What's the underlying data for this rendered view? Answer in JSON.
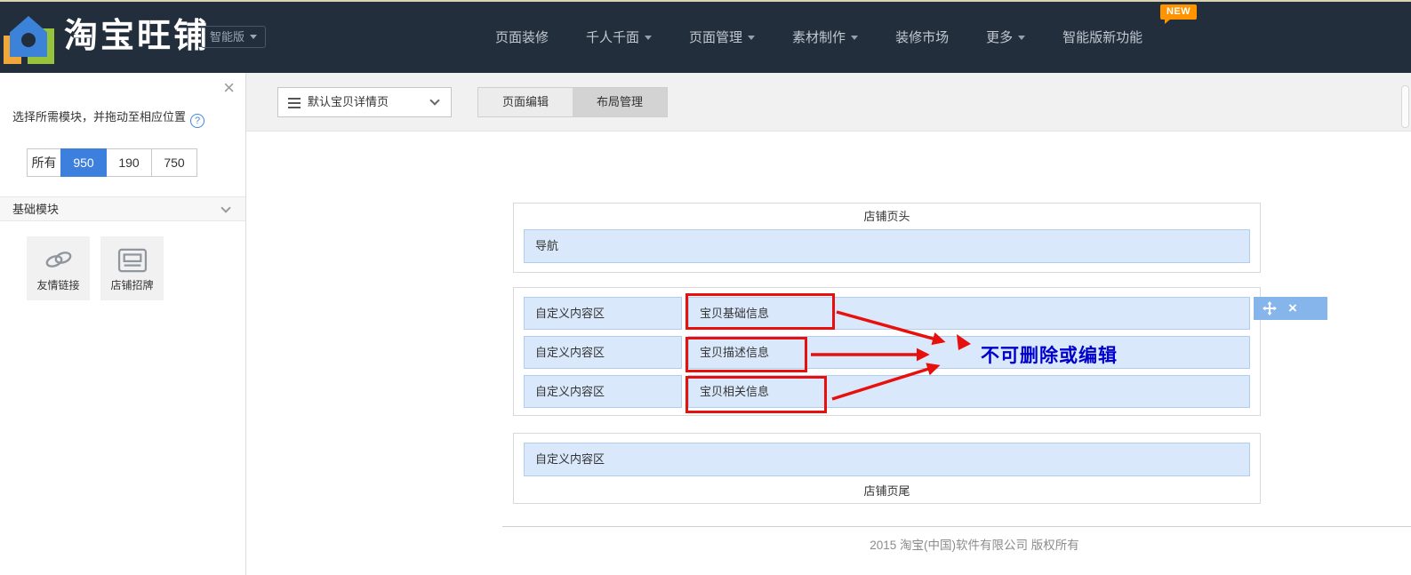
{
  "header": {
    "logo_text": "淘宝旺铺",
    "version_button": "智能版",
    "nav": [
      {
        "label": "页面装修",
        "dropdown": false
      },
      {
        "label": "千人千面",
        "dropdown": true
      },
      {
        "label": "页面管理",
        "dropdown": true
      },
      {
        "label": "素材制作",
        "dropdown": true
      },
      {
        "label": "装修市场",
        "dropdown": false
      },
      {
        "label": "更多",
        "dropdown": true
      },
      {
        "label": "智能版新功能",
        "dropdown": false,
        "badge": "NEW"
      }
    ]
  },
  "sidebar": {
    "instruction": "选择所需模块，并拖动至相应位置",
    "size_tabs": [
      {
        "label": "所有",
        "active": false
      },
      {
        "label": "950",
        "active": true
      },
      {
        "label": "190",
        "active": false
      },
      {
        "label": "750",
        "active": false
      }
    ],
    "section_title": "基础模块",
    "modules": [
      {
        "label": "友情链接",
        "icon": "link-icon"
      },
      {
        "label": "店铺招牌",
        "icon": "banner-icon"
      }
    ]
  },
  "toolbar": {
    "page_select_value": "默认宝贝详情页",
    "tabs": [
      {
        "label": "页面编辑",
        "active": false
      },
      {
        "label": "布局管理",
        "active": true
      }
    ]
  },
  "preview": {
    "header_box": {
      "title": "店铺页头",
      "nav_bar": "导航"
    },
    "content_rows": [
      {
        "left": "自定义内容区",
        "right": "宝贝基础信息"
      },
      {
        "left": "自定义内容区",
        "right": "宝贝描述信息"
      },
      {
        "left": "自定义内容区",
        "right": "宝贝相关信息"
      }
    ],
    "footer_box": {
      "bar": "自定义内容区",
      "title": "店铺页尾"
    },
    "annotation_note": "不可删除或编辑",
    "copyright": "2015 淘宝(中国)软件有限公司 版权所有"
  },
  "icons": {
    "close": "×",
    "help": "?"
  },
  "colors": {
    "header_bg": "#222e3c",
    "accent_blue": "#3d7fdd",
    "badge_orange": "#ff9400",
    "module_fill": "#d9e8fb",
    "module_border": "#b0ccee",
    "annotation_red": "#e8100c",
    "note_blue": "#0000cc",
    "row_toolbar_blue": "#85b5ea"
  }
}
